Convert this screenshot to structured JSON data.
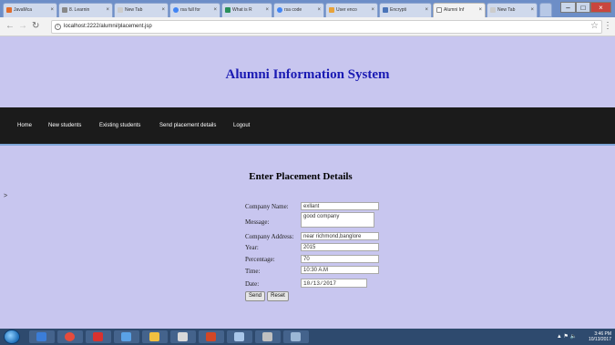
{
  "browser": {
    "tabs": [
      {
        "label": "JavaMca",
        "color": "#e06c2b"
      },
      {
        "label": "8. Learnin",
        "color": "#888888"
      },
      {
        "label": "New Tab",
        "color": "#cccccc"
      },
      {
        "label": "rsa full for",
        "color": "#4285f4"
      },
      {
        "label": "What is R",
        "color": "#2a8f5a"
      },
      {
        "label": "rsa code",
        "color": "#4285f4"
      },
      {
        "label": "User enco",
        "color": "#e8a33a"
      },
      {
        "label": "Encrypti",
        "color": "#4a74b8"
      },
      {
        "label": "Alumni Inf",
        "color": "#cccccc"
      },
      {
        "label": "New Tab",
        "color": "#cccccc"
      }
    ],
    "active_tab_index": 8,
    "url": "localhost:2222/alumni/placement.jsp"
  },
  "site": {
    "title": "Alumni Information System",
    "nav": [
      "Home",
      "New students",
      "Existing students",
      "Send placement details",
      "Logout"
    ]
  },
  "form": {
    "heading": "Enter Placement Details",
    "side_marker": ">",
    "fields": {
      "company_name": {
        "label": "Company Name:",
        "value": "exllant"
      },
      "message": {
        "label": "Message:",
        "value": "good company"
      },
      "company_address": {
        "label": "Company Address:",
        "value": "near richmond,banglore"
      },
      "year": {
        "label": "Year:",
        "value": "2015"
      },
      "percentage": {
        "label": "Percentage:",
        "value": "70"
      },
      "time": {
        "label": "Time:",
        "value": "10:30 A.M"
      },
      "date": {
        "label": "Date:",
        "value": "10/13/2017"
      }
    },
    "send_label": "Send",
    "reset_label": "Reset"
  },
  "taskbar": {
    "time": "3:46 PM",
    "date": "10/13/2017"
  }
}
